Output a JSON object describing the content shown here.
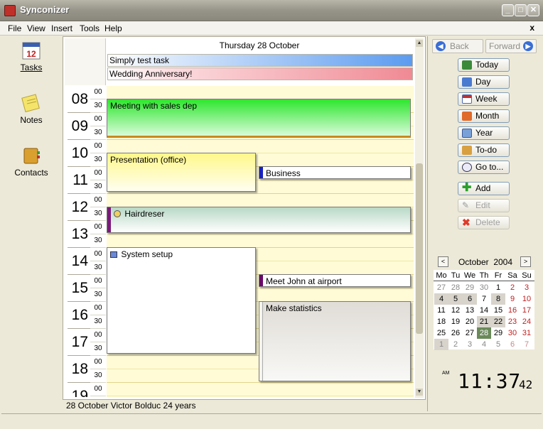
{
  "window": {
    "title": "Synconizer",
    "min": "_",
    "max": "□",
    "close": "✕"
  },
  "menu": {
    "items": [
      "File",
      "View",
      "Insert",
      "Tools",
      "Help"
    ],
    "close_label": "x"
  },
  "sidebar": {
    "items": [
      {
        "label": "Tasks",
        "icon": "calendar-icon"
      },
      {
        "label": "Notes",
        "icon": "notes-icon"
      },
      {
        "label": "Contacts",
        "icon": "contacts-icon"
      }
    ]
  },
  "calendar": {
    "date_header": "Thursday 28 October",
    "allday": [
      {
        "title": "Simply test task",
        "color": "#5b9bf0"
      },
      {
        "title": "Wedding Anniversary!",
        "color": "#f08a94"
      }
    ],
    "hours": [
      "08",
      "09",
      "10",
      "11",
      "12",
      "13",
      "14",
      "15",
      "16",
      "17",
      "18",
      "19"
    ],
    "half_labels": [
      "00",
      "30"
    ],
    "events": [
      {
        "title": "Meeting with sales dep",
        "color": "#2ee62e"
      },
      {
        "title": "Presentation (office)",
        "color": "#fff88a"
      },
      {
        "title": "Business",
        "color": "#1a22c0"
      },
      {
        "title": "Hairdreser",
        "color": "#b8d8c6"
      },
      {
        "title": "System setup",
        "color": "#ffffff"
      },
      {
        "title": "Meet John at airport",
        "color": "#6a0a6a"
      },
      {
        "title": "Make statistics",
        "color": "#e0dcd6"
      }
    ]
  },
  "status_bar": {
    "text": "28 October   Victor Bolduc   24 years"
  },
  "nav": {
    "back": "Back",
    "forward": "Forward"
  },
  "views": [
    "Today",
    "Day",
    "Week",
    "Month",
    "Year",
    "To-do",
    "Go to..."
  ],
  "actions": [
    {
      "label": "Add",
      "enabled": true
    },
    {
      "label": "Edit",
      "enabled": false
    },
    {
      "label": "Delete",
      "enabled": false
    }
  ],
  "mini_calendar": {
    "prev": "<",
    "next": ">",
    "month": "October",
    "year": "2004",
    "weekdays": [
      "Mo",
      "Tu",
      "We",
      "Th",
      "Fr",
      "Sa",
      "Su"
    ],
    "weeks": [
      [
        "27",
        "28",
        "29",
        "30",
        "1",
        "2",
        "3"
      ],
      [
        "4",
        "5",
        "6",
        "7",
        "8",
        "9",
        "10"
      ],
      [
        "11",
        "12",
        "13",
        "14",
        "15",
        "16",
        "17"
      ],
      [
        "18",
        "19",
        "20",
        "21",
        "22",
        "23",
        "24"
      ],
      [
        "25",
        "26",
        "27",
        "28",
        "29",
        "30",
        "31"
      ],
      [
        "1",
        "2",
        "3",
        "4",
        "5",
        "6",
        "7"
      ]
    ],
    "selected": "28"
  },
  "clock": {
    "ampm": "AM",
    "hm": "11:37",
    "sec": "42"
  }
}
